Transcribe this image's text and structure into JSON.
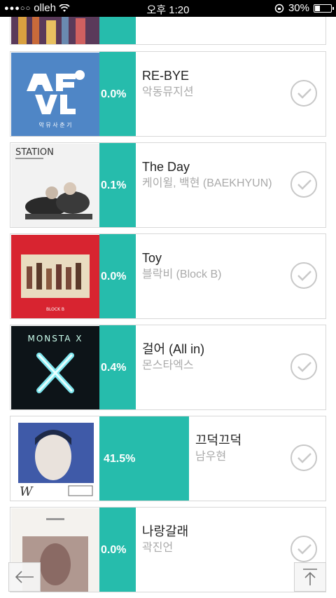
{
  "status_bar": {
    "carrier": "olleh",
    "time": "오후 1:20",
    "battery": "30%",
    "battery_level": 0.3
  },
  "songs": [
    {
      "title": "",
      "artist": "",
      "percent": ""
    },
    {
      "title": "RE-BYE",
      "artist": "악동뮤지션",
      "percent": "0.0%",
      "art_text": "악 뮤 사 춘 기",
      "vote_share": 0.0
    },
    {
      "title": "The Day",
      "artist": "케이윌, 백현 (BAEKHYUN)",
      "percent": "0.1%",
      "art_text": "STATION",
      "vote_share": 0.001
    },
    {
      "title": "Toy",
      "artist": "블락비 (Block B)",
      "percent": "0.0%",
      "art_text": "BLOCK B",
      "vote_share": 0.0
    },
    {
      "title": "걸어 (All in)",
      "artist": "몬스타엑스",
      "percent": "0.4%",
      "art_text": "MONSTA X",
      "vote_share": 0.004
    },
    {
      "title": "끄덕끄덕",
      "artist": "남우현",
      "percent": "41.5%",
      "art_text": "W",
      "vote_share": 0.415
    },
    {
      "title": "나랑갈래",
      "artist": "곽진언",
      "percent": "0.0%",
      "vote_share": 0.0
    }
  ],
  "colors": {
    "accent": "#26bcac"
  },
  "icons": {
    "back": "arrow-left-icon",
    "top": "arrow-up-to-top-icon",
    "check": "check-circle-icon"
  }
}
